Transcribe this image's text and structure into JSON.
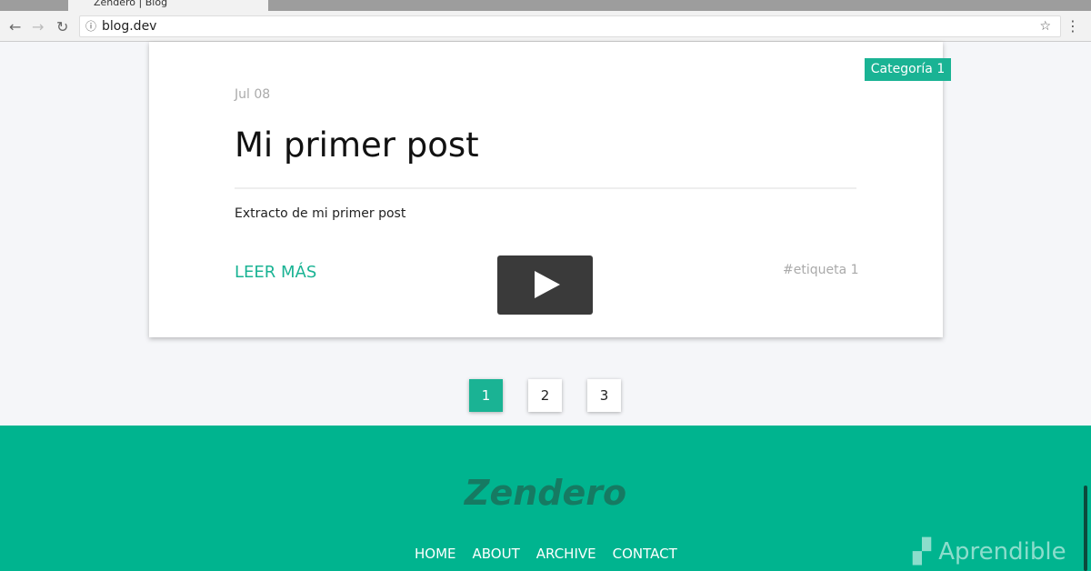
{
  "browser": {
    "tab_title": "Zendero | Blog",
    "url": "blog.dev"
  },
  "post": {
    "category": "Categoría 1",
    "date": "Jul 08",
    "title": "Mi primer post",
    "excerpt": "Extracto de mi primer post",
    "read_more": "LEER MÁS",
    "tag": "#etiqueta 1"
  },
  "pagination": {
    "pages": [
      "1",
      "2",
      "3"
    ],
    "current": "1"
  },
  "footer": {
    "brand": "Zendero",
    "links": [
      "HOME",
      "ABOUT",
      "ARCHIVE",
      "CONTACT"
    ]
  },
  "watermark": "Aprendible",
  "colors": {
    "accent": "#1ab394",
    "footer": "#00b48f"
  }
}
